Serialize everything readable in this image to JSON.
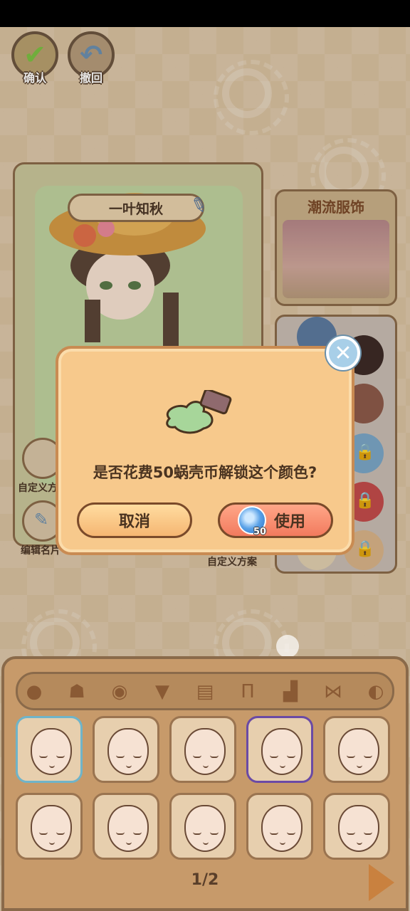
{
  "top_bar": {
    "confirm_label": "确认",
    "undo_label": "撤回"
  },
  "editor": {
    "tabs": [
      "person-icon",
      "cat-icon",
      "cat-icon"
    ],
    "character_name": "一叶知秋",
    "side_buttons": {
      "custom_label": "自定义方",
      "edit_name_label": "编辑名片"
    },
    "custom_scheme_label": "自定义方案"
  },
  "trend_panel": {
    "title": "潮流服饰"
  },
  "color_panel": {
    "swatches": [
      "#5b7aa0",
      "#3b2a26",
      "#8c5a4a",
      "#7aa6c8",
      "#c24b4b",
      "#d8b48a",
      "#ffffff",
      "#e0d0b0"
    ]
  },
  "modal": {
    "message": "是否花费50蜗壳币解锁这个颜色?",
    "cancel_label": "取消",
    "use_label": "使用",
    "coin_cost": "50"
  },
  "tray": {
    "categories": [
      "face-icon",
      "hair-icon",
      "eye-icon",
      "top-icon",
      "coat-icon",
      "pants-icon",
      "shoe-icon",
      "bow-icon",
      "accessory-icon"
    ],
    "faces": [
      {
        "state": "current"
      },
      {
        "state": "normal"
      },
      {
        "state": "normal"
      },
      {
        "state": "selected"
      },
      {
        "state": "normal"
      },
      {
        "state": "normal"
      },
      {
        "state": "normal"
      },
      {
        "state": "normal"
      },
      {
        "state": "normal"
      },
      {
        "state": "normal"
      }
    ],
    "page_indicator": "1/2"
  }
}
